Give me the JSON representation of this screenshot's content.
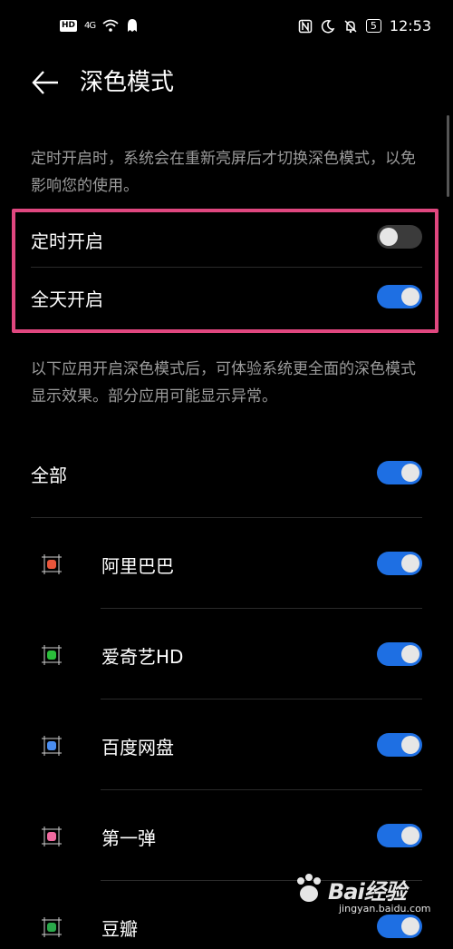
{
  "status_bar": {
    "hd": "HD",
    "signal": "4G",
    "battery": "5",
    "time": "12:53",
    "icons": [
      "wifi-icon",
      "ghost-icon",
      "nfc-icon",
      "moon-icon",
      "bell-off-icon",
      "battery-icon"
    ]
  },
  "header": {
    "title": "深色模式",
    "back_icon": "back-arrow-icon"
  },
  "schedule_note": "定时开启时，系统会在重新亮屏后才切换深色模式，以免影响您的使用。",
  "settings": [
    {
      "label": "定时开启",
      "enabled": false
    },
    {
      "label": "全天开启",
      "enabled": true
    }
  ],
  "apps_note": "以下应用开启深色模式后，可体验系统更全面的深色模式显示效果。部分应用可能显示异常。",
  "all_toggle": {
    "label": "全部",
    "enabled": true
  },
  "apps": [
    {
      "label": "阿里巴巴",
      "enabled": true,
      "icon_color": "#e8553b"
    },
    {
      "label": "爱奇艺HD",
      "enabled": true,
      "icon_color": "#2bbf3b"
    },
    {
      "label": "百度网盘",
      "enabled": true,
      "icon_color": "#4a8df0"
    },
    {
      "label": "第一弹",
      "enabled": true,
      "icon_color": "#f06aa0"
    },
    {
      "label": "豆瓣",
      "enabled": true,
      "icon_color": "#2aa84a"
    }
  ],
  "watermark": {
    "brand": "Bai经验",
    "url": "jingyan.baidu.com"
  },
  "colors": {
    "background": "#000000",
    "toggle_on": "#1e6fe3",
    "toggle_off": "#3b3b3b",
    "highlight": "#e0477f"
  }
}
